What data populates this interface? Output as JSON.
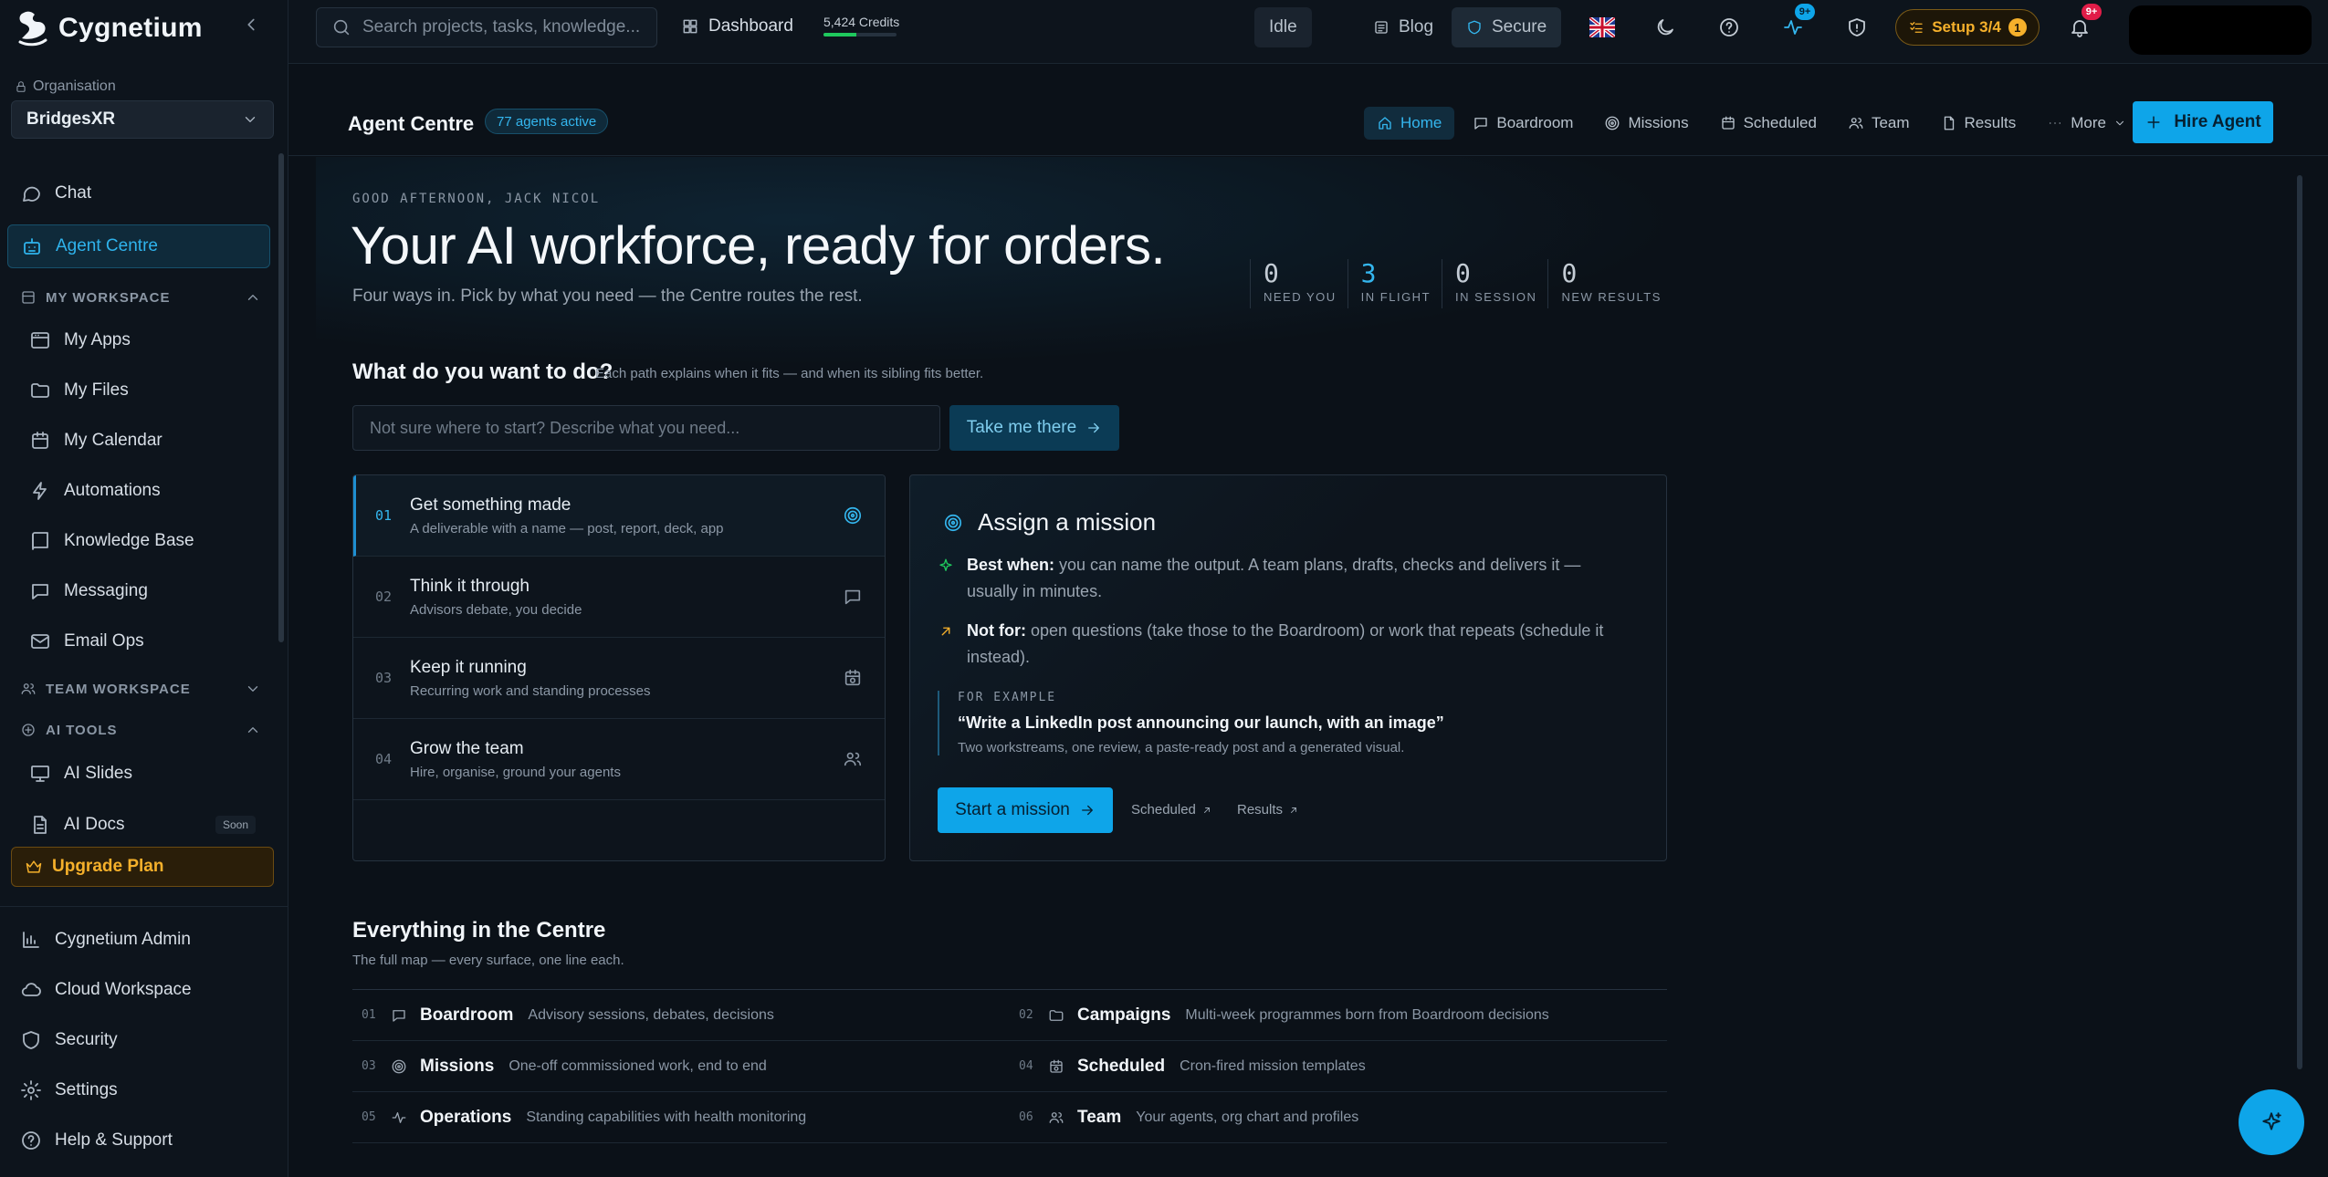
{
  "brand": {
    "name": "Cygnetium"
  },
  "sidebar": {
    "org_label": "Organisation",
    "org_value": "BridgesXR",
    "items_top": [
      {
        "label": "Chat",
        "icon": "chat-bubble-icon"
      },
      {
        "label": "Agent Centre",
        "icon": "robot-icon",
        "active": true
      }
    ],
    "my_workspace": {
      "header": "MY WORKSPACE",
      "items": [
        {
          "label": "My Apps",
          "icon": "apps-window-icon"
        },
        {
          "label": "My Files",
          "icon": "folder-icon"
        },
        {
          "label": "My Calendar",
          "icon": "calendar-icon"
        },
        {
          "label": "Automations",
          "icon": "lightning-icon"
        },
        {
          "label": "Knowledge Base",
          "icon": "book-icon"
        },
        {
          "label": "Messaging",
          "icon": "message-icon"
        },
        {
          "label": "Email Ops",
          "icon": "mail-icon"
        }
      ]
    },
    "team_workspace": {
      "header": "TEAM WORKSPACE"
    },
    "ai_tools": {
      "header": "AI TOOLS",
      "items": [
        {
          "label": "AI Slides",
          "icon": "presentation-icon"
        },
        {
          "label": "AI Docs",
          "icon": "document-icon",
          "badge": "Soon"
        }
      ]
    },
    "upgrade_label": "Upgrade Plan",
    "bottom_items": [
      {
        "label": "Cygnetium Admin",
        "icon": "bar-chart-icon"
      },
      {
        "label": "Cloud Workspace",
        "icon": "cloud-icon"
      },
      {
        "label": "Security",
        "icon": "shield-icon"
      },
      {
        "label": "Settings",
        "icon": "gear-icon"
      },
      {
        "label": "Help & Support",
        "icon": "help-circle-icon"
      }
    ]
  },
  "topbar": {
    "search_placeholder": "Search projects, tasks, knowledge...",
    "dashboard_label": "Dashboard",
    "credits_label": "5,424 Credits",
    "credits_fraction": 0.45,
    "status_label": "Idle",
    "blog_label": "Blog",
    "secure_label": "Secure",
    "activity_badge": "9+",
    "setup_label": "Setup 3/4",
    "setup_count": "1",
    "notifications_badge": "9+"
  },
  "subheader": {
    "title": "Agent Centre",
    "agents_badge": "77 agents active",
    "tabs": [
      {
        "label": "Home",
        "icon": "home-icon",
        "active": true
      },
      {
        "label": "Boardroom",
        "icon": "chat-bubble-icon"
      },
      {
        "label": "Missions",
        "icon": "target-icon"
      },
      {
        "label": "Scheduled",
        "icon": "calendar-icon"
      },
      {
        "label": "Team",
        "icon": "users-icon"
      },
      {
        "label": "Results",
        "icon": "file-icon"
      },
      {
        "label": "More",
        "icon": "ellipsis-icon"
      }
    ],
    "hire_label": "Hire Agent"
  },
  "hero": {
    "greeting": "GOOD AFTERNOON, JACK NICOL",
    "headline": "Your AI workforce, ready for orders.",
    "subline": "Four ways in. Pick by what you need — the Centre routes the rest.",
    "stats": [
      {
        "value": "0",
        "label": "NEED YOU"
      },
      {
        "value": "3",
        "label": "IN FLIGHT",
        "highlight": true
      },
      {
        "value": "0",
        "label": "IN SESSION"
      },
      {
        "value": "0",
        "label": "NEW RESULTS"
      }
    ]
  },
  "question": {
    "title": "What do you want to do?",
    "subtitle": "Each path explains when it fits — and when its sibling fits better.",
    "input_placeholder": "Not sure where to start? Describe what you need...",
    "button_label": "Take me there"
  },
  "paths": [
    {
      "num": "01",
      "title": "Get something made",
      "desc": "A deliverable with a name — post, report, deck, app",
      "icon": "target-icon",
      "active": true
    },
    {
      "num": "02",
      "title": "Think it through",
      "desc": "Advisors debate, you decide",
      "icon": "chat-bubble-icon"
    },
    {
      "num": "03",
      "title": "Keep it running",
      "desc": "Recurring work and standing processes",
      "icon": "calendar-clock-icon"
    },
    {
      "num": "04",
      "title": "Grow the team",
      "desc": "Hire, organise, ground your agents",
      "icon": "users-icon"
    }
  ],
  "detail": {
    "title": "Assign a mission",
    "best_label": "Best when:",
    "best_text": "you can name the output. A team plans, drafts, checks and delivers it — usually in minutes.",
    "not_label": "Not for:",
    "not_text": "open questions (take those to the Boardroom) or work that repeats (schedule it instead).",
    "example_label": "FOR EXAMPLE",
    "example_quote": "“Write a LinkedIn post announcing our launch, with an image”",
    "example_desc": "Two workstreams, one review, a paste-ready post and a generated visual.",
    "start_label": "Start a mission",
    "link_scheduled": "Scheduled",
    "link_results": "Results"
  },
  "everything": {
    "title": "Everything in the Centre",
    "subtitle": "The full map — every surface, one line each.",
    "rows": [
      {
        "num": "01",
        "name": "Boardroom",
        "desc": "Advisory sessions, debates, decisions",
        "icon": "chat-bubble-icon"
      },
      {
        "num": "02",
        "name": "Campaigns",
        "desc": "Multi-week programmes born from Boardroom decisions",
        "icon": "folder-icon"
      },
      {
        "num": "03",
        "name": "Missions",
        "desc": "One-off commissioned work, end to end",
        "icon": "target-icon"
      },
      {
        "num": "04",
        "name": "Scheduled",
        "desc": "Cron-fired mission templates",
        "icon": "calendar-clock-icon"
      },
      {
        "num": "05",
        "name": "Operations",
        "desc": "Standing capabilities with health monitoring",
        "icon": "pulse-icon"
      },
      {
        "num": "06",
        "name": "Team",
        "desc": "Your agents, org chart and profiles",
        "icon": "users-icon"
      }
    ]
  },
  "colors": {
    "accent": "#0ea5e9",
    "warning": "#f5b02b",
    "danger": "#e11d48",
    "success": "#1fc95d"
  }
}
